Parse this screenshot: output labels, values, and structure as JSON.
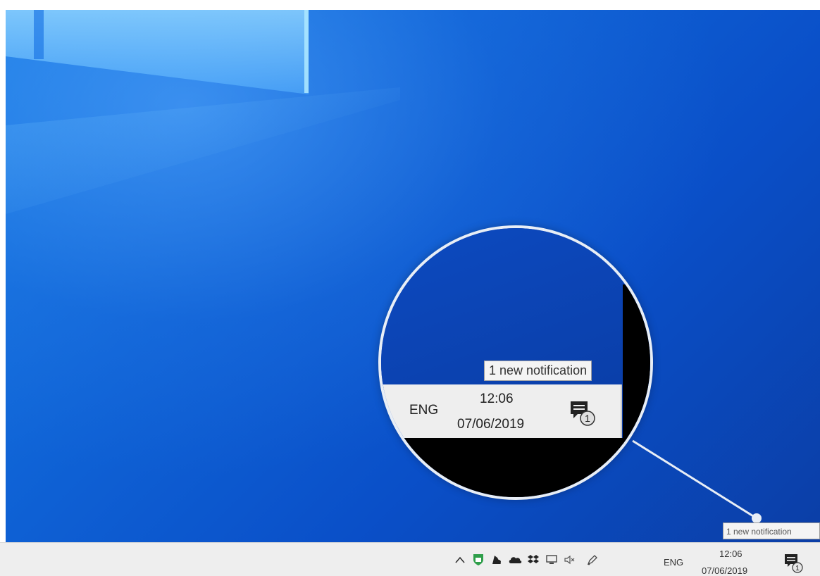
{
  "magnifier": {
    "tooltip": "1 new notification",
    "language": "ENG",
    "time": "12:06",
    "date": "07/06/2019",
    "badge_count": "1"
  },
  "taskbar": {
    "tooltip": "1 new notification",
    "language": "ENG",
    "time": "12:06",
    "date": "07/06/2019",
    "badge_count": "1",
    "tray_icons": [
      "chevron-up-icon",
      "security-shield-icon",
      "app-icon",
      "onedrive-cloud-icon",
      "dropbox-icon",
      "network-monitor-icon",
      "volume-muted-icon",
      "pen-icon"
    ]
  },
  "colors": {
    "desktop_blue": "#0f63d6",
    "taskbar_bg": "#eeeeee",
    "shield_green": "#2e9e4a"
  }
}
